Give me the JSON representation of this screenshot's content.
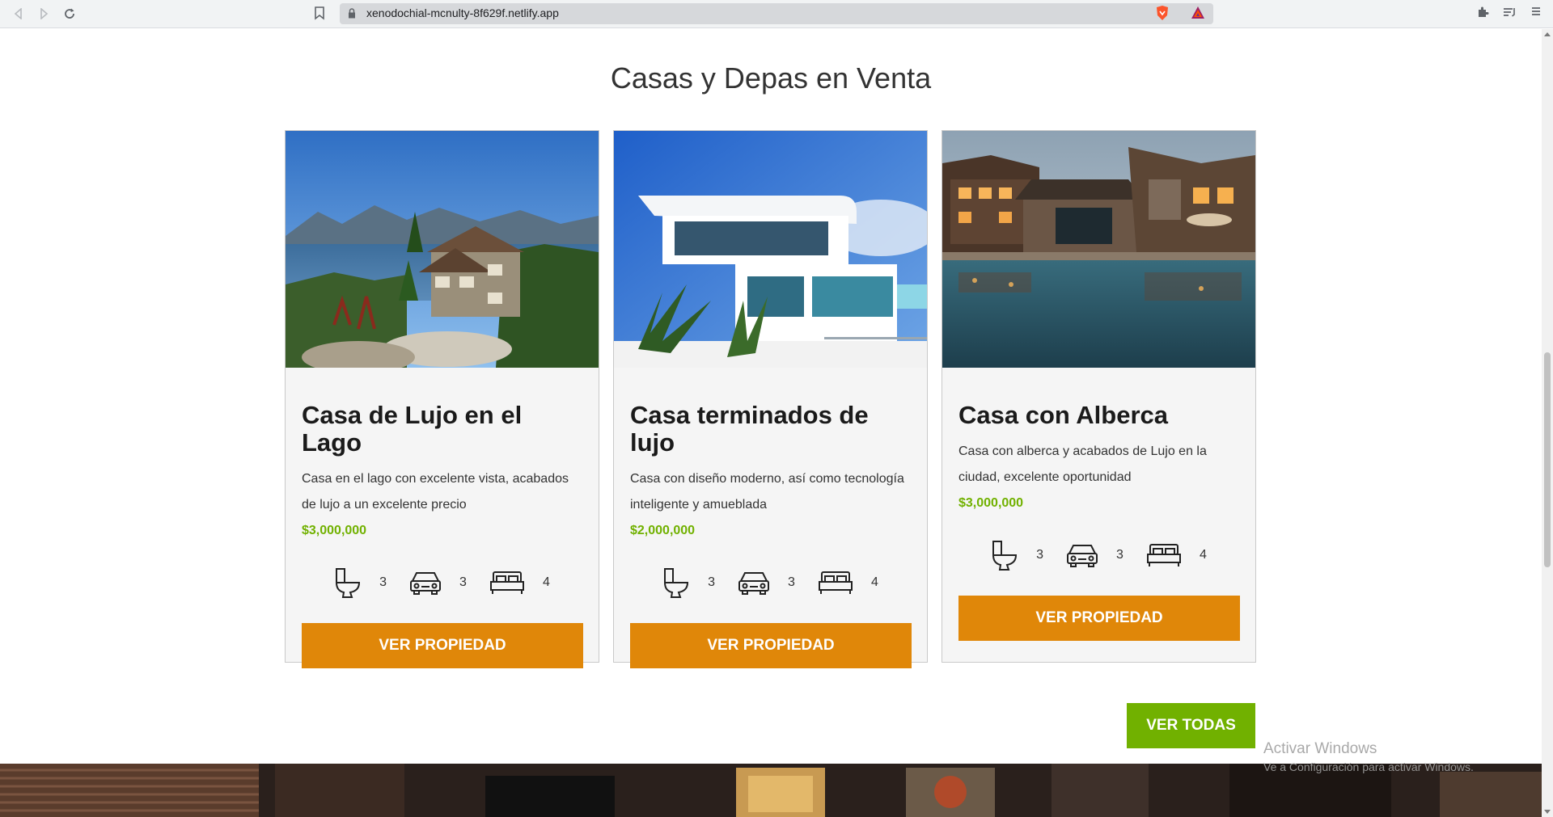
{
  "browser": {
    "url": "xenodochial-mcnulty-8f629f.netlify.app",
    "icons": [
      "back-icon",
      "forward-icon",
      "reload-icon",
      "bookmark-icon",
      "lock-icon",
      "brave-shield-icon",
      "bat-rewards-icon",
      "extensions-icon",
      "reading-list-icon",
      "menu-icon"
    ]
  },
  "section": {
    "title": "Casas y Depas en Venta"
  },
  "listings": [
    {
      "title": "Casa de Lujo en el Lago",
      "description": "Casa en el lago con excelente vista, acabados de lujo a un excelente precio",
      "price": "$3,000,000",
      "bathrooms": "3",
      "parking": "3",
      "bedrooms": "4",
      "button": "VER PROPIEDAD"
    },
    {
      "title": "Casa terminados de lujo",
      "description": "Casa con diseño moderno, así como tecnología inteligente y amueblada",
      "price": "$2,000,000",
      "bathrooms": "3",
      "parking": "3",
      "bedrooms": "4",
      "button": "VER PROPIEDAD"
    },
    {
      "title": "Casa con Alberca",
      "description": "Casa con alberca y acabados de Lujo en la ciudad, excelente oportunidad",
      "price": "$3,000,000",
      "bathrooms": "3",
      "parking": "3",
      "bedrooms": "4",
      "button": "VER PROPIEDAD"
    }
  ],
  "view_all": "VER TODAS",
  "watermark": {
    "title": "Activar Windows",
    "subtitle": "Ve a Configuración para activar Windows."
  },
  "colors": {
    "accent_orange": "#e08709",
    "accent_green": "#71b100"
  }
}
